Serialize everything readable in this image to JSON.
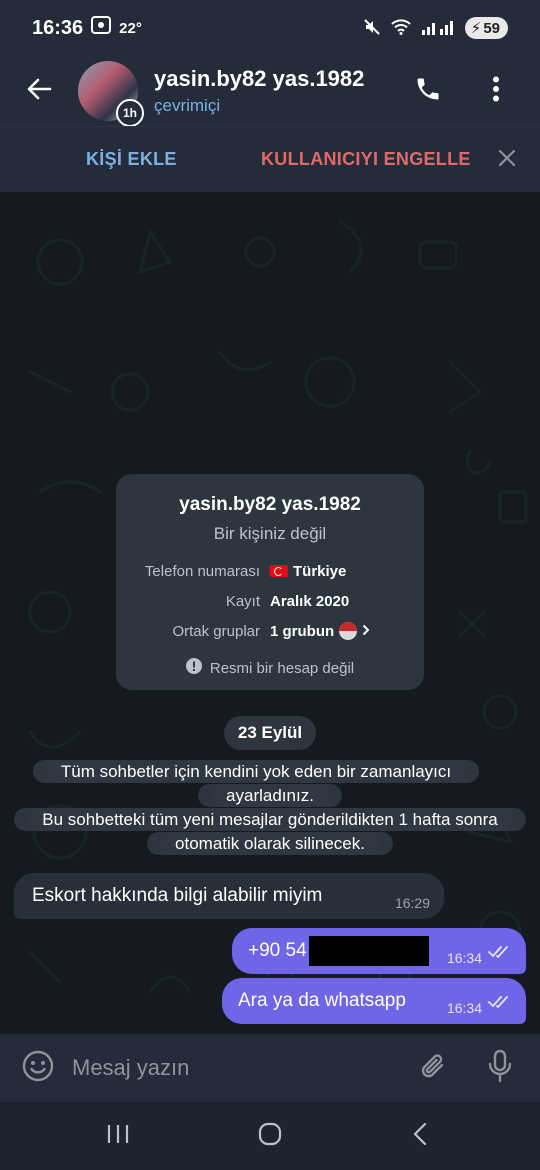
{
  "status_bar": {
    "time": "16:36",
    "temperature": "22°",
    "battery": "59"
  },
  "header": {
    "title": "yasin.by82 yas.1982",
    "subtitle": "çevrimiçi",
    "avatar_timer": "1h"
  },
  "action_bar": {
    "add_contact": "KİŞİ EKLE",
    "block_user": "KULLANICIYI ENGELLE"
  },
  "info_card": {
    "name": "yasin.by82 yas.1982",
    "status": "Bir kişiniz değil",
    "rows": [
      {
        "key": "Telefon numarası",
        "value": "Türkiye"
      },
      {
        "key": "Kayıt",
        "value": "Aralık 2020"
      },
      {
        "key": "Ortak gruplar",
        "value": "1 grubun"
      }
    ],
    "official_notice": "Resmi bir hesap değil"
  },
  "date_chip": "23 Eylül",
  "service_message": {
    "line1": "Tüm sohbetler için kendini yok eden bir zamanlayıcı ayarladınız.",
    "line2": "Bu sohbetteki tüm yeni mesajlar gönderildikten 1 hafta sonra otomatik olarak silinecek."
  },
  "messages": [
    {
      "direction": "in",
      "text": "Eskort hakkında bilgi alabilir miyim",
      "time": "16:29"
    },
    {
      "direction": "out",
      "text": "+90 54",
      "time": "16:34",
      "redacted": true
    },
    {
      "direction": "out",
      "text": "Ara ya da whatsapp",
      "time": "16:34"
    }
  ],
  "composer": {
    "placeholder": "Mesaj yazın"
  },
  "colors": {
    "accent": "#7ab0e6",
    "danger": "#e06a6a",
    "outgoing_bubble": "#6e66e6",
    "incoming_bubble": "#272f3a",
    "header_bg": "#232c38"
  },
  "icons": [
    "back-arrow-icon",
    "phone-icon",
    "more-vertical-icon",
    "close-icon",
    "info-icon",
    "chevron-right-icon",
    "emoji-icon",
    "attach-icon",
    "mic-icon",
    "double-check-icon",
    "recents-icon",
    "home-icon",
    "nav-back-icon"
  ]
}
